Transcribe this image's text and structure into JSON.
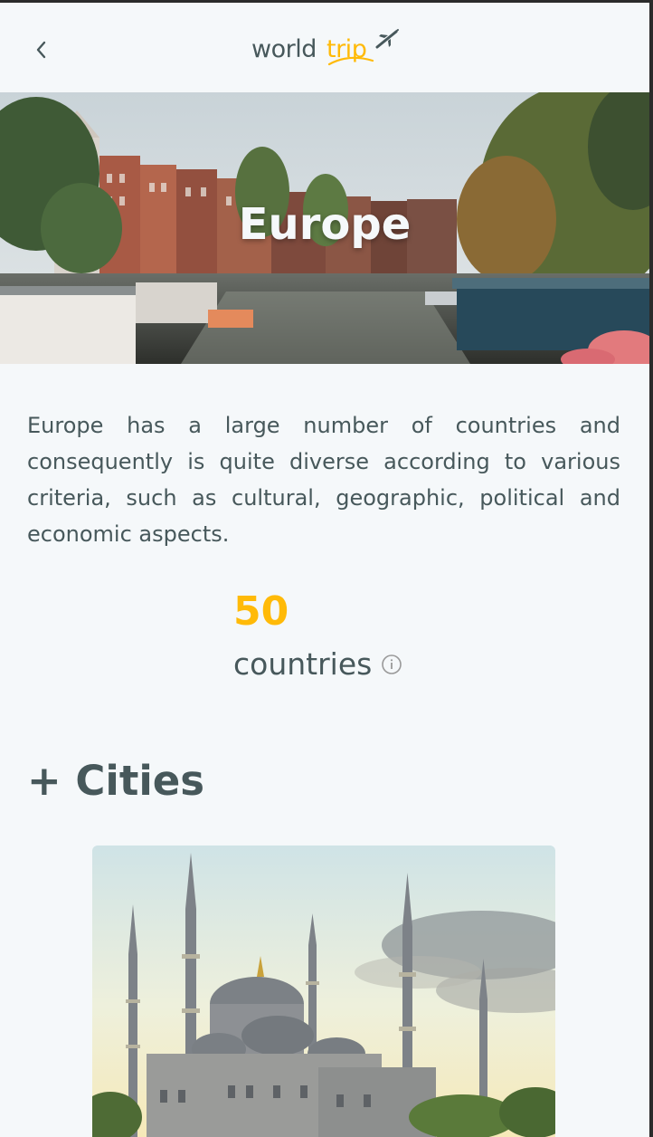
{
  "header": {
    "back_icon": "chevron-left-icon",
    "logo": {
      "part1": "world",
      "part2": "trip",
      "icon": "airplane-icon"
    }
  },
  "banner": {
    "title": "Europe"
  },
  "description": "Europe has a large number of countries and consequently is quite diverse according to various criteria, such as cultural, geographic, political and economic aspects.",
  "stats": {
    "number": "50",
    "label": "countries",
    "info_icon": "info-icon"
  },
  "cities": {
    "heading": "+ Cities"
  },
  "colors": {
    "background": "#F5F8FA",
    "text": "#47585B",
    "accent": "#FFBA08",
    "light": "#F5F8FA"
  }
}
